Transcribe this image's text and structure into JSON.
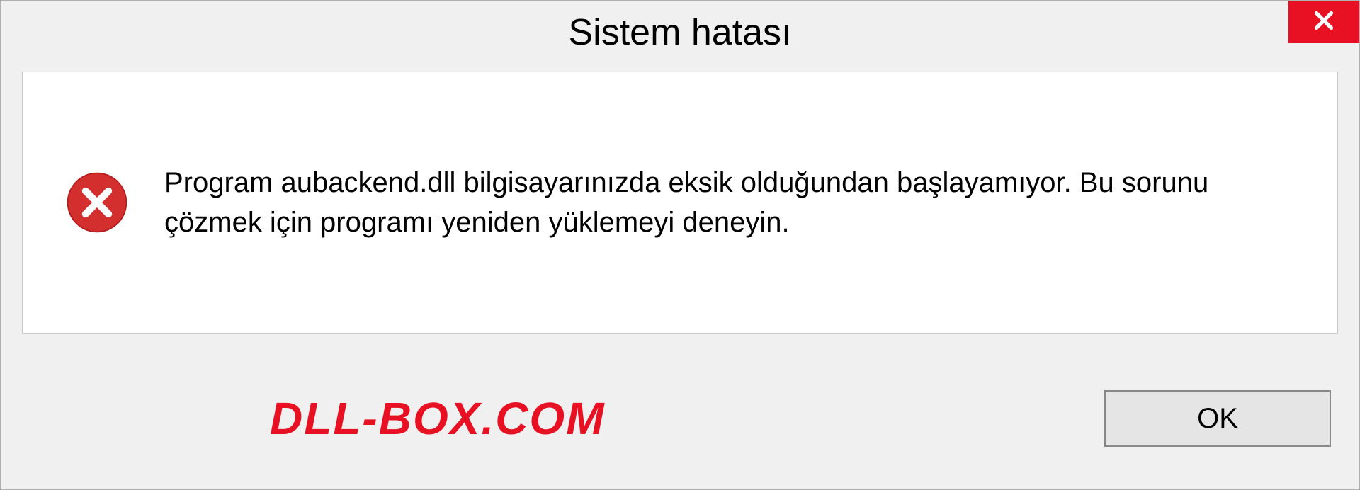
{
  "dialog": {
    "title": "Sistem hatası",
    "message": "Program aubackend.dll bilgisayarınızda eksik olduğundan başlayamıyor. Bu sorunu çözmek için programı yeniden yüklemeyi deneyin.",
    "ok_label": "OK"
  },
  "watermark": "DLL-BOX.COM",
  "colors": {
    "close_bg": "#e81123",
    "error_icon": "#d32f2f",
    "watermark": "#e81123"
  }
}
